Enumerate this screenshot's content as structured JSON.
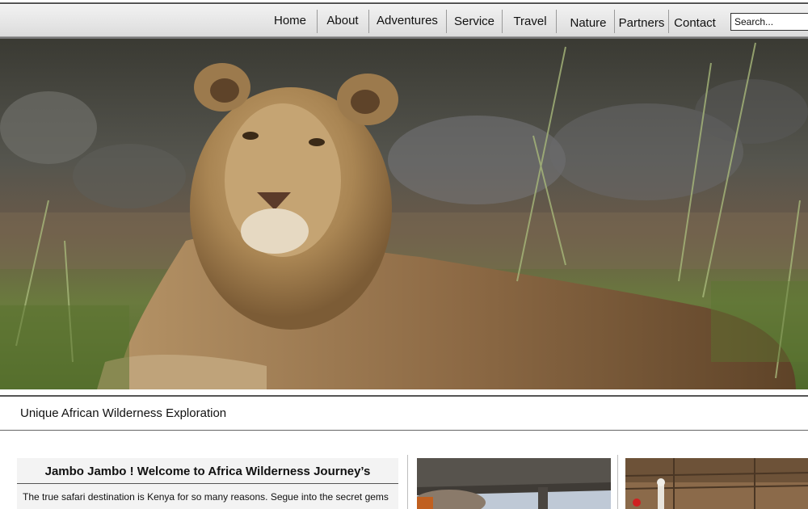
{
  "nav": {
    "items": [
      {
        "label": "Home"
      },
      {
        "label": "About"
      },
      {
        "label": "Adventures"
      },
      {
        "label": "Service"
      },
      {
        "label": "Travel"
      },
      {
        "label": "Nature"
      },
      {
        "label": "Partners"
      },
      {
        "label": "Contact"
      }
    ],
    "search_placeholder": "Search..."
  },
  "hero": {
    "image_subject": "lion resting in tall grass"
  },
  "tagline": "Unique African Wilderness Exploration",
  "welcome": {
    "title": "Jambo Jambo ! Welcome to Africa Wilderness Journey’s",
    "text": "The true safari destination is Kenya for so many reasons. Segue into the secret gems"
  },
  "colors": {
    "nav_bg": "#e6e6e6",
    "welcome_bg": "#f3f3f3",
    "text": "#111111"
  }
}
